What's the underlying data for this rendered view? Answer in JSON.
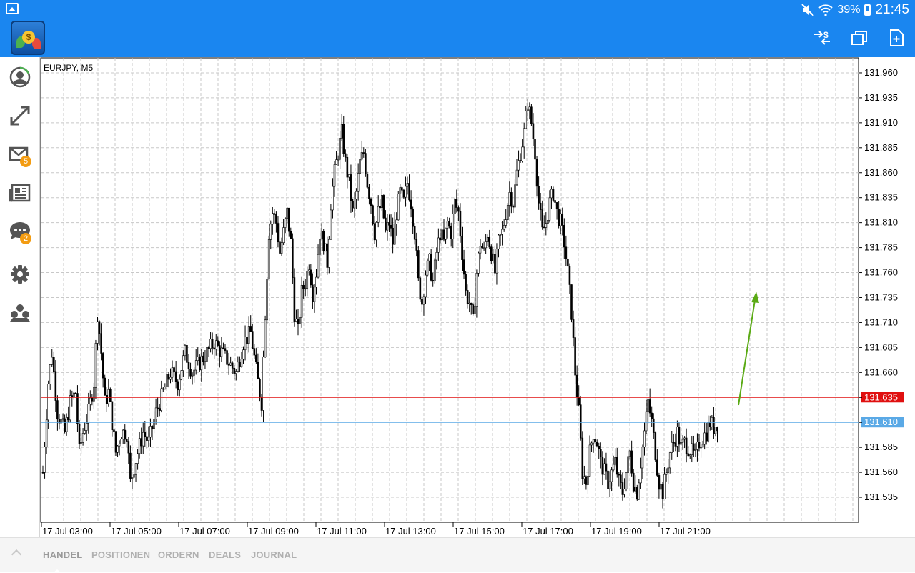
{
  "status_bar": {
    "battery": "39%",
    "time": "21:45",
    "icons": [
      "gallery-icon",
      "mute-icon",
      "wifi-icon",
      "battery-icon"
    ]
  },
  "app_bar": {
    "logo": "metatrader-logo",
    "actions": [
      "currency-switch-icon",
      "window-icon",
      "new-chart-icon"
    ]
  },
  "sidebar": {
    "items": [
      {
        "icon": "account-icon"
      },
      {
        "icon": "trade-icon"
      },
      {
        "icon": "mail-icon",
        "badge": "5"
      },
      {
        "icon": "news-icon"
      },
      {
        "icon": "chat-icon",
        "badge": "2"
      },
      {
        "icon": "settings-icon"
      },
      {
        "icon": "community-icon"
      }
    ]
  },
  "chart": {
    "symbol": "EURJPY, M5",
    "colors": {
      "candle": "#000000",
      "grid": "#c8c8c8",
      "ask_line": "#e01010",
      "bid_line": "#5aa9e6",
      "arrow": "#5aaa14"
    }
  },
  "chart_data": {
    "type": "candlestick",
    "symbol": "EURJPY",
    "timeframe": "M5",
    "ylim": [
      131.51,
      131.975
    ],
    "y_ticks": [
      "131.960",
      "131.935",
      "131.910",
      "131.885",
      "131.860",
      "131.835",
      "131.810",
      "131.785",
      "131.760",
      "131.735",
      "131.710",
      "131.685",
      "131.660",
      "131.635",
      "131.610",
      "131.585",
      "131.560",
      "131.535"
    ],
    "x_ticks": [
      "17 Jul 03:00",
      "17 Jul 05:00",
      "17 Jul 07:00",
      "17 Jul 09:00",
      "17 Jul 11:00",
      "17 Jul 13:00",
      "17 Jul 15:00",
      "17 Jul 17:00",
      "17 Jul 19:00",
      "17 Jul 21:00"
    ],
    "ask_price": "131.635",
    "bid_price": "131.610",
    "annotation": "upward-arrow",
    "path_points": [
      [
        0,
        131.56
      ],
      [
        3,
        131.65
      ],
      [
        5,
        131.68
      ],
      [
        8,
        131.62
      ],
      [
        12,
        131.6
      ],
      [
        15,
        131.63
      ],
      [
        18,
        131.64
      ],
      [
        20,
        131.58
      ],
      [
        22,
        131.6
      ],
      [
        25,
        131.62
      ],
      [
        28,
        131.65
      ],
      [
        30,
        131.72
      ],
      [
        32,
        131.68
      ],
      [
        34,
        131.63
      ],
      [
        36,
        131.64
      ],
      [
        40,
        131.58
      ],
      [
        43,
        131.6
      ],
      [
        46,
        131.6
      ],
      [
        48,
        131.55
      ],
      [
        52,
        131.58
      ],
      [
        55,
        131.6
      ],
      [
        58,
        131.59
      ],
      [
        62,
        131.62
      ],
      [
        66,
        131.64
      ],
      [
        70,
        131.66
      ],
      [
        74,
        131.65
      ],
      [
        78,
        131.68
      ],
      [
        82,
        131.66
      ],
      [
        86,
        131.67
      ],
      [
        90,
        131.68
      ],
      [
        94,
        131.69
      ],
      [
        98,
        131.68
      ],
      [
        102,
        131.67
      ],
      [
        106,
        131.66
      ],
      [
        110,
        131.69
      ],
      [
        114,
        131.7
      ],
      [
        118,
        131.65
      ],
      [
        120,
        131.63
      ],
      [
        122,
        131.72
      ],
      [
        124,
        131.8
      ],
      [
        126,
        131.82
      ],
      [
        128,
        131.81
      ],
      [
        130,
        131.78
      ],
      [
        132,
        131.8
      ],
      [
        134,
        131.82
      ],
      [
        136,
        131.79
      ],
      [
        138,
        131.72
      ],
      [
        140,
        131.7
      ],
      [
        142,
        131.74
      ],
      [
        144,
        131.75
      ],
      [
        146,
        131.77
      ],
      [
        148,
        131.74
      ],
      [
        150,
        131.76
      ],
      [
        152,
        131.8
      ],
      [
        154,
        131.79
      ],
      [
        156,
        131.77
      ],
      [
        158,
        131.83
      ],
      [
        160,
        131.86
      ],
      [
        162,
        131.88
      ],
      [
        164,
        131.9
      ],
      [
        166,
        131.87
      ],
      [
        168,
        131.85
      ],
      [
        170,
        131.82
      ],
      [
        172,
        131.84
      ],
      [
        174,
        131.87
      ],
      [
        176,
        131.88
      ],
      [
        178,
        131.85
      ],
      [
        180,
        131.83
      ],
      [
        182,
        131.8
      ],
      [
        184,
        131.82
      ],
      [
        186,
        131.83
      ],
      [
        188,
        131.8
      ],
      [
        190,
        131.81
      ],
      [
        192,
        131.79
      ],
      [
        194,
        131.82
      ],
      [
        196,
        131.84
      ],
      [
        198,
        131.83
      ],
      [
        200,
        131.85
      ],
      [
        202,
        131.83
      ],
      [
        204,
        131.8
      ],
      [
        206,
        131.75
      ],
      [
        208,
        131.73
      ],
      [
        210,
        131.76
      ],
      [
        212,
        131.77
      ],
      [
        214,
        131.75
      ],
      [
        216,
        131.78
      ],
      [
        218,
        131.8
      ],
      [
        220,
        131.79
      ],
      [
        222,
        131.81
      ],
      [
        224,
        131.8
      ],
      [
        226,
        131.83
      ],
      [
        228,
        131.82
      ],
      [
        230,
        131.78
      ],
      [
        232,
        131.74
      ],
      [
        234,
        131.73
      ],
      [
        236,
        131.71
      ],
      [
        238,
        131.76
      ],
      [
        240,
        131.79
      ],
      [
        242,
        131.78
      ],
      [
        244,
        131.8
      ],
      [
        246,
        131.78
      ],
      [
        248,
        131.76
      ],
      [
        250,
        131.79
      ],
      [
        252,
        131.8
      ],
      [
        254,
        131.82
      ],
      [
        256,
        131.84
      ],
      [
        258,
        131.83
      ],
      [
        260,
        131.86
      ],
      [
        262,
        131.88
      ],
      [
        264,
        131.9
      ],
      [
        266,
        131.93
      ],
      [
        268,
        131.91
      ],
      [
        270,
        131.88
      ],
      [
        272,
        131.83
      ],
      [
        274,
        131.8
      ],
      [
        276,
        131.81
      ],
      [
        278,
        131.83
      ],
      [
        280,
        131.84
      ],
      [
        282,
        131.82
      ],
      [
        284,
        131.81
      ],
      [
        286,
        131.79
      ],
      [
        288,
        131.76
      ],
      [
        290,
        131.72
      ],
      [
        292,
        131.66
      ],
      [
        294,
        131.62
      ],
      [
        296,
        131.56
      ],
      [
        298,
        131.55
      ],
      [
        300,
        131.58
      ],
      [
        302,
        131.6
      ],
      [
        304,
        131.59
      ],
      [
        306,
        131.57
      ],
      [
        308,
        131.56
      ],
      [
        310,
        131.55
      ],
      [
        312,
        131.56
      ],
      [
        314,
        131.57
      ],
      [
        316,
        131.55
      ],
      [
        318,
        131.54
      ],
      [
        320,
        131.56
      ],
      [
        322,
        131.58
      ],
      [
        324,
        131.55
      ],
      [
        326,
        131.54
      ],
      [
        328,
        131.57
      ],
      [
        330,
        131.6
      ],
      [
        332,
        131.63
      ],
      [
        334,
        131.61
      ],
      [
        336,
        131.58
      ],
      [
        338,
        131.55
      ],
      [
        340,
        131.54
      ],
      [
        342,
        131.56
      ],
      [
        344,
        131.58
      ],
      [
        346,
        131.59
      ],
      [
        348,
        131.6
      ],
      [
        350,
        131.585
      ],
      [
        352,
        131.59
      ],
      [
        354,
        131.585
      ],
      [
        356,
        131.58
      ],
      [
        358,
        131.575
      ],
      [
        360,
        131.59
      ],
      [
        362,
        131.595
      ],
      [
        364,
        131.6
      ],
      [
        366,
        131.61
      ],
      [
        368,
        131.605
      ],
      [
        370,
        131.61
      ]
    ]
  },
  "tabs": [
    {
      "label": "HANDEL",
      "active": true
    },
    {
      "label": "POSITIONEN",
      "active": false
    },
    {
      "label": "ORDERN",
      "active": false
    },
    {
      "label": "DEALS",
      "active": false
    },
    {
      "label": "JOURNAL",
      "active": false
    }
  ]
}
